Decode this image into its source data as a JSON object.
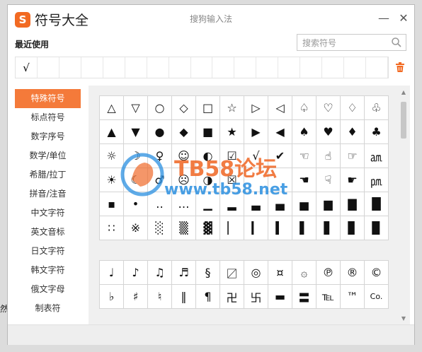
{
  "background_text": "然",
  "title_bar": {
    "logo_text": "S",
    "app_title": "符号大全",
    "window_title": "搜狗输入法",
    "minimize_label": "—",
    "close_label": "✕"
  },
  "recent": {
    "label": "最近使用",
    "symbols": [
      "√",
      "",
      "",
      "",
      "",
      "",
      "",
      "",
      "",
      "",
      "",
      "",
      "",
      "",
      "",
      "",
      ""
    ]
  },
  "search": {
    "placeholder": "搜索符号",
    "value": ""
  },
  "sidebar": {
    "items": [
      {
        "label": "特殊符号",
        "active": true
      },
      {
        "label": "标点符号"
      },
      {
        "label": "数字序号"
      },
      {
        "label": "数学/单位"
      },
      {
        "label": "希腊/拉丁"
      },
      {
        "label": "拼音/注音"
      },
      {
        "label": "中文字符"
      },
      {
        "label": "英文音标"
      },
      {
        "label": "日文字符"
      },
      {
        "label": "韩文字符"
      },
      {
        "label": "俄文字母"
      },
      {
        "label": "制表符"
      }
    ]
  },
  "grid1": [
    "△",
    "▽",
    "○",
    "◇",
    "□",
    "☆",
    "▷",
    "◁",
    "♤",
    "♡",
    "♢",
    "♧",
    "▲",
    "▼",
    "●",
    "◆",
    "■",
    "★",
    "▶",
    "◀",
    "♠",
    "♥",
    "♦",
    "♣",
    "☼",
    "☽",
    "♀",
    "☺",
    "◐",
    "☑",
    "√",
    "✔",
    "☜",
    "☝",
    "☞",
    "㏂",
    "☀",
    "☾",
    "♂",
    "☹",
    "◑",
    "☒",
    "",
    "",
    "☚",
    "☟",
    "☛",
    "㏘",
    "▪",
    "•",
    "‥",
    "…",
    "▁",
    "▂",
    "▃",
    "▄",
    "▅",
    "▆",
    "▇",
    "█",
    "∷",
    "※",
    "░",
    "▒",
    "▓",
    "▏",
    "▎",
    "▍",
    "▌",
    "▋",
    "▊",
    "▉"
  ],
  "grid2": [
    "♩",
    "♪",
    "♫",
    "♬",
    "§",
    "〼",
    "◎",
    "¤",
    "۞",
    "℗",
    "®",
    "©",
    "♭",
    "♯",
    "♮",
    "‖",
    "¶",
    "卍",
    "卐",
    "▬",
    "〓",
    "℡",
    "™",
    "Co."
  ],
  "watermark": {
    "title": "TB58论坛",
    "url": "www.tb58.net"
  }
}
